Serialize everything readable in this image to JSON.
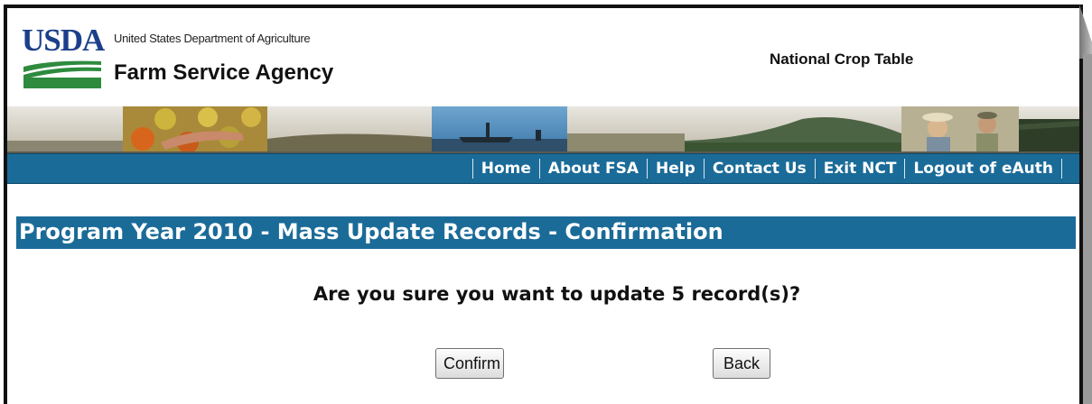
{
  "header": {
    "logo_text": "USDA",
    "department": "United States Department of Agriculture",
    "agency": "Farm Service Agency",
    "app_title": "National Crop Table"
  },
  "nav": {
    "items": [
      "Home",
      "About FSA",
      "Help",
      "Contact Us",
      "Exit NCT",
      "Logout of eAuth"
    ]
  },
  "page": {
    "title": "Program Year 2010 - Mass Update Records - Confirmation",
    "question": "Are you sure you want to update 5 record(s)?",
    "confirm_label": "Confirm",
    "back_label": "Back"
  },
  "colors": {
    "nav_blue": "#1b6b98",
    "usda_blue": "#1b3f8b",
    "usda_green": "#2e8b3e"
  }
}
